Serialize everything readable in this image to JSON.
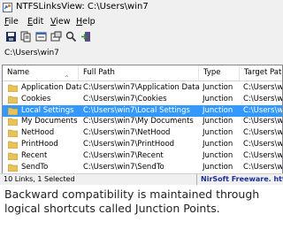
{
  "window": {
    "title": "NTFSLinksView:  C:\\Users\\win7",
    "icon": "app-link-icon"
  },
  "menu": [
    {
      "key": "F",
      "rest": "ile"
    },
    {
      "key": "E",
      "rest": "dit"
    },
    {
      "key": "V",
      "rest": "iew"
    },
    {
      "key": "H",
      "rest": "elp"
    }
  ],
  "toolbar": {
    "icons": [
      "save-icon",
      "copy-icon",
      "refresh-icon",
      "properties-icon",
      "find-icon",
      "exit-icon"
    ]
  },
  "path": {
    "value": "C:\\Users\\win7"
  },
  "table": {
    "columns": [
      "Name",
      "Full Path",
      "Type",
      "Target Path"
    ],
    "sort_indicator": "^",
    "rows": [
      {
        "name": "Application Data",
        "full_path": "C:\\Users\\win7\\Application Data",
        "type": "Junction",
        "target": "C:\\Users\\w"
      },
      {
        "name": "Cookies",
        "full_path": "C:\\Users\\win7\\Cookies",
        "type": "Junction",
        "target": "C:\\Users\\w"
      },
      {
        "name": "Local Settings",
        "full_path": "C:\\Users\\win7\\Local Settings",
        "type": "Junction",
        "target": "C:\\Users\\w",
        "selected": true
      },
      {
        "name": "My Documents",
        "full_path": "C:\\Users\\win7\\My Documents",
        "type": "Junction",
        "target": "C:\\Users\\w"
      },
      {
        "name": "NetHood",
        "full_path": "C:\\Users\\win7\\NetHood",
        "type": "Junction",
        "target": "C:\\Users\\w"
      },
      {
        "name": "PrintHood",
        "full_path": "C:\\Users\\win7\\PrintHood",
        "type": "Junction",
        "target": "C:\\Users\\w"
      },
      {
        "name": "Recent",
        "full_path": "C:\\Users\\win7\\Recent",
        "type": "Junction",
        "target": "C:\\Users\\w"
      },
      {
        "name": "SendTo",
        "full_path": "C:\\Users\\win7\\SendTo",
        "type": "Junction",
        "target": "C:\\Users\\w"
      }
    ]
  },
  "status": {
    "left": "10 Links, 1 Selected",
    "right": "NirSoft Freeware.  http:"
  },
  "caption": {
    "line1": "Backward compatibility is maintained through",
    "line2": "logical shortcuts called Junction Points."
  },
  "colors": {
    "selection": "#3399ff",
    "folder": "#e8c25a",
    "status_link": "#1a2d9a"
  }
}
